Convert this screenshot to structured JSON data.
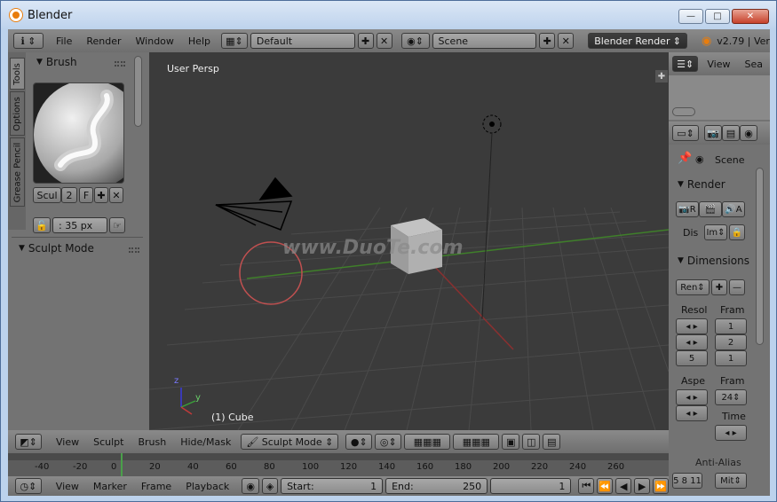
{
  "window": {
    "title": "Blender",
    "min": "—",
    "max": "□",
    "close": "✕"
  },
  "info_header": {
    "menus": [
      "File",
      "Render",
      "Window",
      "Help"
    ],
    "layout_value": "Default",
    "scene_value": "Scene",
    "engine_value": "Blender Render",
    "version": "v2.79 | Ver"
  },
  "tool_tabs": [
    "Tools",
    "Options",
    "Grease Pencil"
  ],
  "brush_panel": {
    "title": "Brush",
    "brush_name": "Scul",
    "users": "2",
    "fake_user": "F",
    "radius": ": 35 px"
  },
  "sculpt_panel": {
    "title": "Sculpt Mode"
  },
  "viewport": {
    "view_label": "User Persp",
    "object_label": "(1) Cube",
    "watermark": "www.DuoTe.com",
    "axis_x": "x",
    "axis_y": "y",
    "axis_z": "z"
  },
  "view3d_header": {
    "menus": [
      "View",
      "Sculpt",
      "Brush",
      "Hide/Mask"
    ],
    "mode": "Sculpt Mode"
  },
  "timeline": {
    "ticks": [
      "-40",
      "-20",
      "0",
      "20",
      "40",
      "60",
      "80",
      "100",
      "120",
      "140",
      "160",
      "180",
      "200",
      "220",
      "240",
      "260"
    ],
    "current_frame": 0
  },
  "timeline_header": {
    "menus": [
      "View",
      "Marker",
      "Frame",
      "Playback"
    ],
    "start_label": "Start:",
    "start_value": "1",
    "end_label": "End:",
    "end_value": "250",
    "current": "1"
  },
  "outliner": {
    "menus": [
      "View",
      "Sea"
    ]
  },
  "properties": {
    "scene_label": "Scene",
    "render_title": "Render",
    "render_btn": "R",
    "anim_btn": "",
    "audio_btn": "A",
    "display_label": "Dis",
    "display_value": "Im",
    "dimensions_title": "Dimensions",
    "preset_value": "Ren",
    "resol_label": "Resol",
    "fram_label": "Fram",
    "res_pct": "5",
    "frame_vals": [
      "1",
      "2",
      "1"
    ],
    "aspect_label": "Aspe",
    "fps_label": "Fram",
    "fps_value": "24",
    "time_label": "Time",
    "anti_alias": "Anti-Alias",
    "aa_vals": [
      "5",
      "8",
      "11"
    ],
    "mitch": "Mit"
  },
  "colors": {
    "accent": "#e87d0d",
    "viewport_bg": "#3b3b3b",
    "x_axis": "#a03a3a",
    "y_axis": "#3a8a2a"
  }
}
